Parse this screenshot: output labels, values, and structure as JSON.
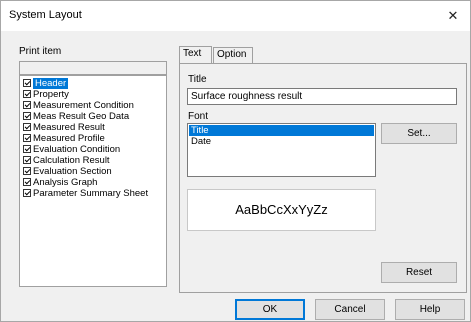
{
  "window": {
    "title": "System Layout",
    "close_glyph": "✕"
  },
  "print_item": {
    "label": "Print item",
    "items": [
      {
        "label": "Header",
        "checked": true,
        "selected": true
      },
      {
        "label": "Property",
        "checked": true
      },
      {
        "label": "Measurement Condition",
        "checked": true
      },
      {
        "label": "Meas Result Geo Data",
        "checked": true
      },
      {
        "label": "Measured Result",
        "checked": true
      },
      {
        "label": "Measured Profile",
        "checked": true
      },
      {
        "label": "Evaluation Condition",
        "checked": true
      },
      {
        "label": "Calculation Result",
        "checked": true
      },
      {
        "label": "Evaluation Section",
        "checked": true
      },
      {
        "label": "Analysis Graph",
        "checked": true
      },
      {
        "label": "Parameter Summary Sheet",
        "checked": true
      }
    ]
  },
  "tabs": [
    {
      "label": "Text",
      "active": true
    },
    {
      "label": "Option",
      "active": false
    }
  ],
  "text_tab": {
    "title_label": "Title",
    "title_value": "Surface roughness result",
    "font_label": "Font",
    "font_items": [
      {
        "label": "Title",
        "selected": true
      },
      {
        "label": "Date",
        "selected": false
      }
    ],
    "set_button": "Set...",
    "preview_text": "AaBbCcXxYyZz",
    "reset_button": "Reset"
  },
  "footer": {
    "ok": "OK",
    "cancel": "Cancel",
    "help": "Help"
  },
  "colors": {
    "selection": "#0078d7",
    "dialog_bg": "#f0f0f0"
  }
}
